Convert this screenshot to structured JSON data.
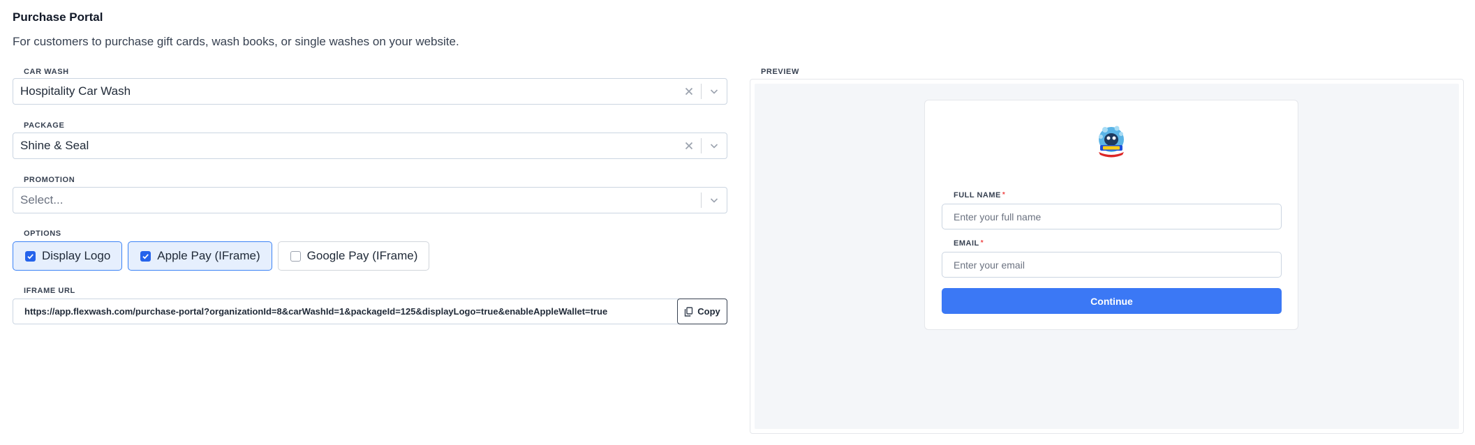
{
  "page": {
    "title": "Purchase Portal",
    "description": "For customers to purchase gift cards, wash books, or single washes on your website."
  },
  "car_wash": {
    "label": "CAR WASH",
    "value": "Hospitality Car Wash"
  },
  "package": {
    "label": "PACKAGE",
    "value": "Shine & Seal"
  },
  "promotion": {
    "label": "PROMOTION",
    "placeholder": "Select..."
  },
  "options": {
    "label": "OPTIONS",
    "items": [
      {
        "label": "Display Logo",
        "checked": true
      },
      {
        "label": "Apple Pay (IFrame)",
        "checked": true
      },
      {
        "label": "Google Pay (IFrame)",
        "checked": false
      }
    ]
  },
  "iframe": {
    "label": "IFRAME URL",
    "url": "https://app.flexwash.com/purchase-portal?organizationId=8&carWashId=1&packageId=125&displayLogo=true&enableAppleWallet=true",
    "copy_label": "Copy"
  },
  "preview": {
    "label": "PREVIEW",
    "full_name_label": "FULL NAME",
    "full_name_placeholder": "Enter your full name",
    "email_label": "EMAIL",
    "email_placeholder": "Enter your email",
    "required_mark": "*",
    "continue_label": "Continue"
  },
  "colors": {
    "accent": "#3b78f5",
    "checked_bg": "#e6effd",
    "preview_bg": "#f4f6f9",
    "required": "#ef4444"
  }
}
